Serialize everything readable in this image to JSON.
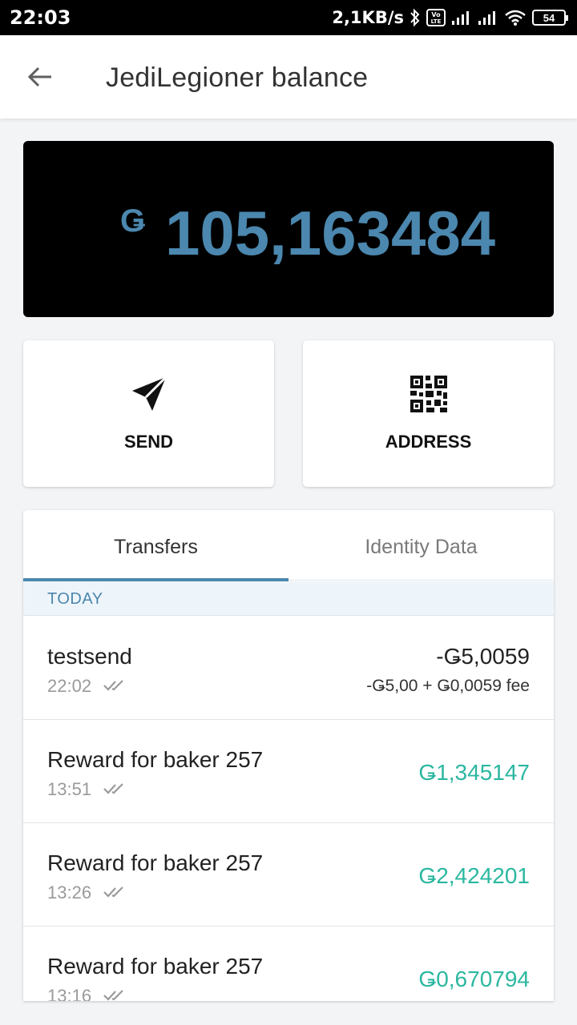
{
  "status_bar": {
    "time": "22:03",
    "net_speed": "2,1KB/s",
    "volte_label": "Vo\nLTE",
    "battery": "54"
  },
  "app_bar": {
    "title": "JediLegioner balance"
  },
  "balance": {
    "currency_symbol": "Ǥ",
    "amount": "105,163484",
    "color": "#4b87ae"
  },
  "actions": {
    "send_label": "SEND",
    "address_label": "ADDRESS"
  },
  "tabs": [
    {
      "label": "Transfers",
      "active": true
    },
    {
      "label": "Identity Data",
      "active": false
    }
  ],
  "date_header": "TODAY",
  "transactions": [
    {
      "name": "testsend",
      "time": "22:02",
      "amount": "-Ǥ5,0059",
      "fee_detail": "-Ǥ5,00 + Ǥ0,0059 fee",
      "type": "outgoing"
    },
    {
      "name": "Reward for baker 257",
      "time": "13:51",
      "amount": "Ǥ1,345147",
      "type": "incoming"
    },
    {
      "name": "Reward for baker 257",
      "time": "13:26",
      "amount": "Ǥ2,424201",
      "type": "incoming"
    },
    {
      "name": "Reward for baker 257",
      "time": "13:16",
      "amount": "Ǥ0,670794",
      "type": "incoming"
    }
  ],
  "colors": {
    "accent": "#4b87ae",
    "incoming": "#2bb7a0"
  }
}
